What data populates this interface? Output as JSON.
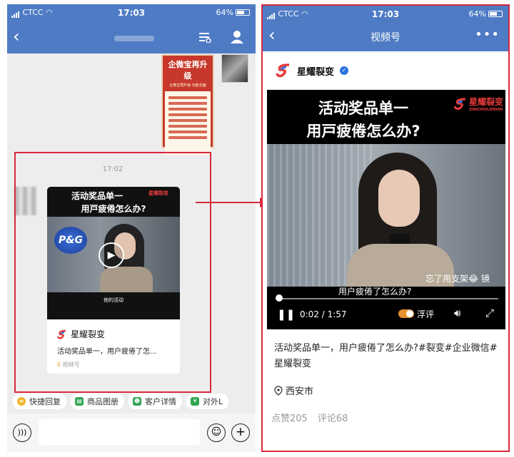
{
  "colors": {
    "nav_blue": "#4e7bc4",
    "highlight_red": "#d8293e",
    "verified_blue": "#2c72e0",
    "toggle_orange": "#e7922d"
  },
  "status_bar": {
    "carrier": "CTCC",
    "time": "17:03",
    "battery": "64%",
    "battery_level": 0.64
  },
  "left_chat": {
    "back_icon": "chevron-left-icon",
    "header_icons": [
      "list-settings-icon",
      "person-icon"
    ],
    "poster": {
      "title": "企微宝再升级",
      "subtitle": "企微宝再升级 功能全面"
    },
    "timestamp": "17:02",
    "channels_card": {
      "caption_line1": "活动奖品单一",
      "caption_line2": "用戸疲倦怎么办?",
      "brand_logo_text": "星耀裂变",
      "pg_logo": "P&G",
      "subtitle": "他的活动",
      "account_name": "星耀裂变",
      "description": "活动奖品单一，用户疲倦了怎...",
      "source": "视频号"
    },
    "quick_actions": [
      {
        "label": "快捷回复",
        "icon": "quick-reply-icon",
        "color": "#f0b429"
      },
      {
        "label": "商品图册",
        "icon": "catalog-icon",
        "color": "#2ea44f"
      },
      {
        "label": "客户详情",
        "icon": "customer-icon",
        "color": "#2ea44f"
      },
      {
        "label": "对外L",
        "icon": "external-icon",
        "color": "#2ea44f"
      }
    ],
    "input_icons": [
      "voice-icon",
      "emoji-icon",
      "plus-icon"
    ]
  },
  "right_channel": {
    "nav_title": "视频号",
    "more_icon": "more-dots-icon",
    "account_name": "星耀裂变",
    "verified_icon": "verified-badge-icon",
    "video": {
      "caption_line1": "活动奖品单一",
      "caption_line2": "用戸疲倦怎么办?",
      "logo_text": "星耀裂变",
      "logo_sub": "XINGYAOLIEBIAN",
      "subtitle_line1": "忘了用支架😂  镜",
      "subtitle_line2": "用户疲倦了怎么办?",
      "time": "0:02 / 1:57",
      "progress": 0.017,
      "danmu_label": "浮评"
    },
    "description": "活动奖品单一，用户疲倦了怎么办?#裂变#企业微信#星耀裂变",
    "location": "西安市",
    "likes": "点赞205",
    "comments": "评论68"
  }
}
